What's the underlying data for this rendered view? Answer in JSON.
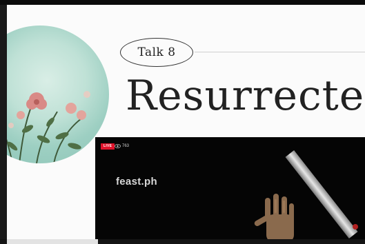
{
  "slide": {
    "talk_label": "Talk 8",
    "title": "Resurrected"
  },
  "video": {
    "live_label": "LIVE",
    "viewer_count": "763",
    "overlay_text": "feast.ph"
  },
  "colors": {
    "live_red": "#e0132b",
    "circle_mint": "#9dcfc2",
    "slide_bg": "#fbfbfb",
    "video_bg": "#050505"
  }
}
